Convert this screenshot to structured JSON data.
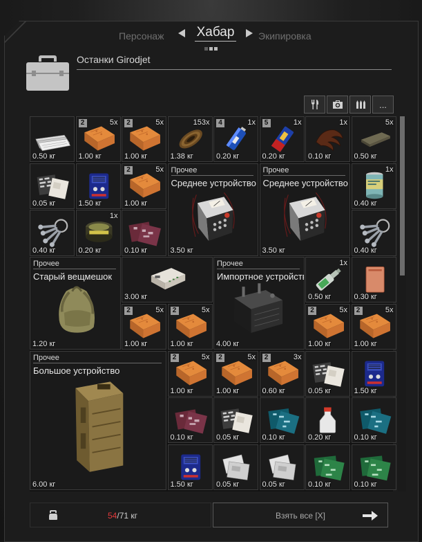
{
  "nav": {
    "left": "Персонаж",
    "center": "Хабар",
    "right": "Экипировка"
  },
  "container": {
    "title": "Останки Girodjet"
  },
  "filters": [
    {
      "icon": "fork-knife-icon",
      "label": ""
    },
    {
      "icon": "medkit-icon",
      "label": ""
    },
    {
      "icon": "ammo-icon",
      "label": ""
    },
    {
      "icon": "more-icon",
      "label": "..."
    }
  ],
  "items": [
    {
      "id": "newspaper",
      "weight": "0.50 кг"
    },
    {
      "id": "brick1",
      "badge": "2",
      "qty": "5x",
      "weight": "1.00 кг"
    },
    {
      "id": "brick2",
      "badge": "2",
      "qty": "5x",
      "weight": "1.00 кг"
    },
    {
      "id": "wire",
      "qty": "153x",
      "weight": "1.38 кг"
    },
    {
      "id": "battery-blue",
      "badge": "4",
      "qty": "1x",
      "weight": "0.20 кг"
    },
    {
      "id": "battery-red",
      "badge": "5",
      "qty": "1x",
      "weight": "0.20 кг"
    },
    {
      "id": "claw",
      "qty": "1x",
      "weight": "0.10 кг"
    },
    {
      "id": "bar",
      "qty": "5x",
      "weight": "0.50 кг"
    },
    {
      "id": "pcbpaper1",
      "weight": "0.05 кг"
    },
    {
      "id": "radio1",
      "weight": "1.50 кг"
    },
    {
      "id": "brick3",
      "badge": "2",
      "qty": "5x",
      "weight": "1.00 кг"
    },
    {
      "id": "device-mid1",
      "category": "Прочее",
      "name": "Среднее устройство",
      "weight": "3.50 кг"
    },
    {
      "id": "device-mid2",
      "category": "Прочее",
      "name": "Среднее устройство",
      "weight": "3.50 кг"
    },
    {
      "id": "can",
      "qty": "1x",
      "weight": "0.40 кг"
    },
    {
      "id": "keys1",
      "weight": "0.40 кг"
    },
    {
      "id": "tin",
      "qty": "1x",
      "weight": "0.20 кг"
    },
    {
      "id": "pcbred1",
      "weight": "0.10 кг"
    },
    {
      "id": "keys2",
      "weight": "0.40 кг"
    },
    {
      "id": "sack",
      "category": "Прочее",
      "name": "Старый вещмешок",
      "weight": "1.20 кг"
    },
    {
      "id": "router",
      "weight": "3.00 кг"
    },
    {
      "id": "device-import",
      "category": "Прочее",
      "name": "Импортное устройств...",
      "weight": "4.00 кг"
    },
    {
      "id": "bottle",
      "qty": "1x",
      "weight": "0.50 кг"
    },
    {
      "id": "redpad",
      "weight": "0.30 кг"
    },
    {
      "id": "brick4",
      "badge": "2",
      "qty": "5x",
      "weight": "1.00 кг"
    },
    {
      "id": "brick5",
      "badge": "2",
      "qty": "5x",
      "weight": "1.00 кг"
    },
    {
      "id": "brick6",
      "badge": "2",
      "qty": "5x",
      "weight": "1.00 кг"
    },
    {
      "id": "brick7",
      "badge": "2",
      "qty": "5x",
      "weight": "1.00 кг"
    },
    {
      "id": "device-big",
      "category": "Прочее",
      "name": "Большое устройство",
      "weight": "6.00 кг"
    },
    {
      "id": "brick8",
      "badge": "2",
      "qty": "5x",
      "weight": "1.00 кг"
    },
    {
      "id": "brick9",
      "badge": "2",
      "qty": "5x",
      "weight": "1.00 кг"
    },
    {
      "id": "brick10",
      "badge": "2",
      "qty": "3x",
      "weight": "0.60 кг"
    },
    {
      "id": "pcbpaper2",
      "weight": "0.05 кг"
    },
    {
      "id": "radio2",
      "weight": "1.50 кг"
    },
    {
      "id": "pcbred2",
      "weight": "0.10 кг"
    },
    {
      "id": "pcbpaper3",
      "weight": "0.05 кг"
    },
    {
      "id": "pcbblue1",
      "weight": "0.10 кг"
    },
    {
      "id": "flask",
      "weight": "0.20 кг"
    },
    {
      "id": "pcbblue2",
      "weight": "0.10 кг"
    },
    {
      "id": "radio3",
      "weight": "1.50 кг"
    },
    {
      "id": "papers1",
      "weight": "0.05 кг"
    },
    {
      "id": "papers2",
      "weight": "0.05 кг"
    },
    {
      "id": "pcbgreen1",
      "weight": "0.10 кг"
    },
    {
      "id": "pcbgreen2",
      "weight": "0.10 кг"
    }
  ],
  "footer": {
    "weight_current": "54",
    "weight_max": "/71 кг",
    "take_all": "Взять все [X]"
  }
}
